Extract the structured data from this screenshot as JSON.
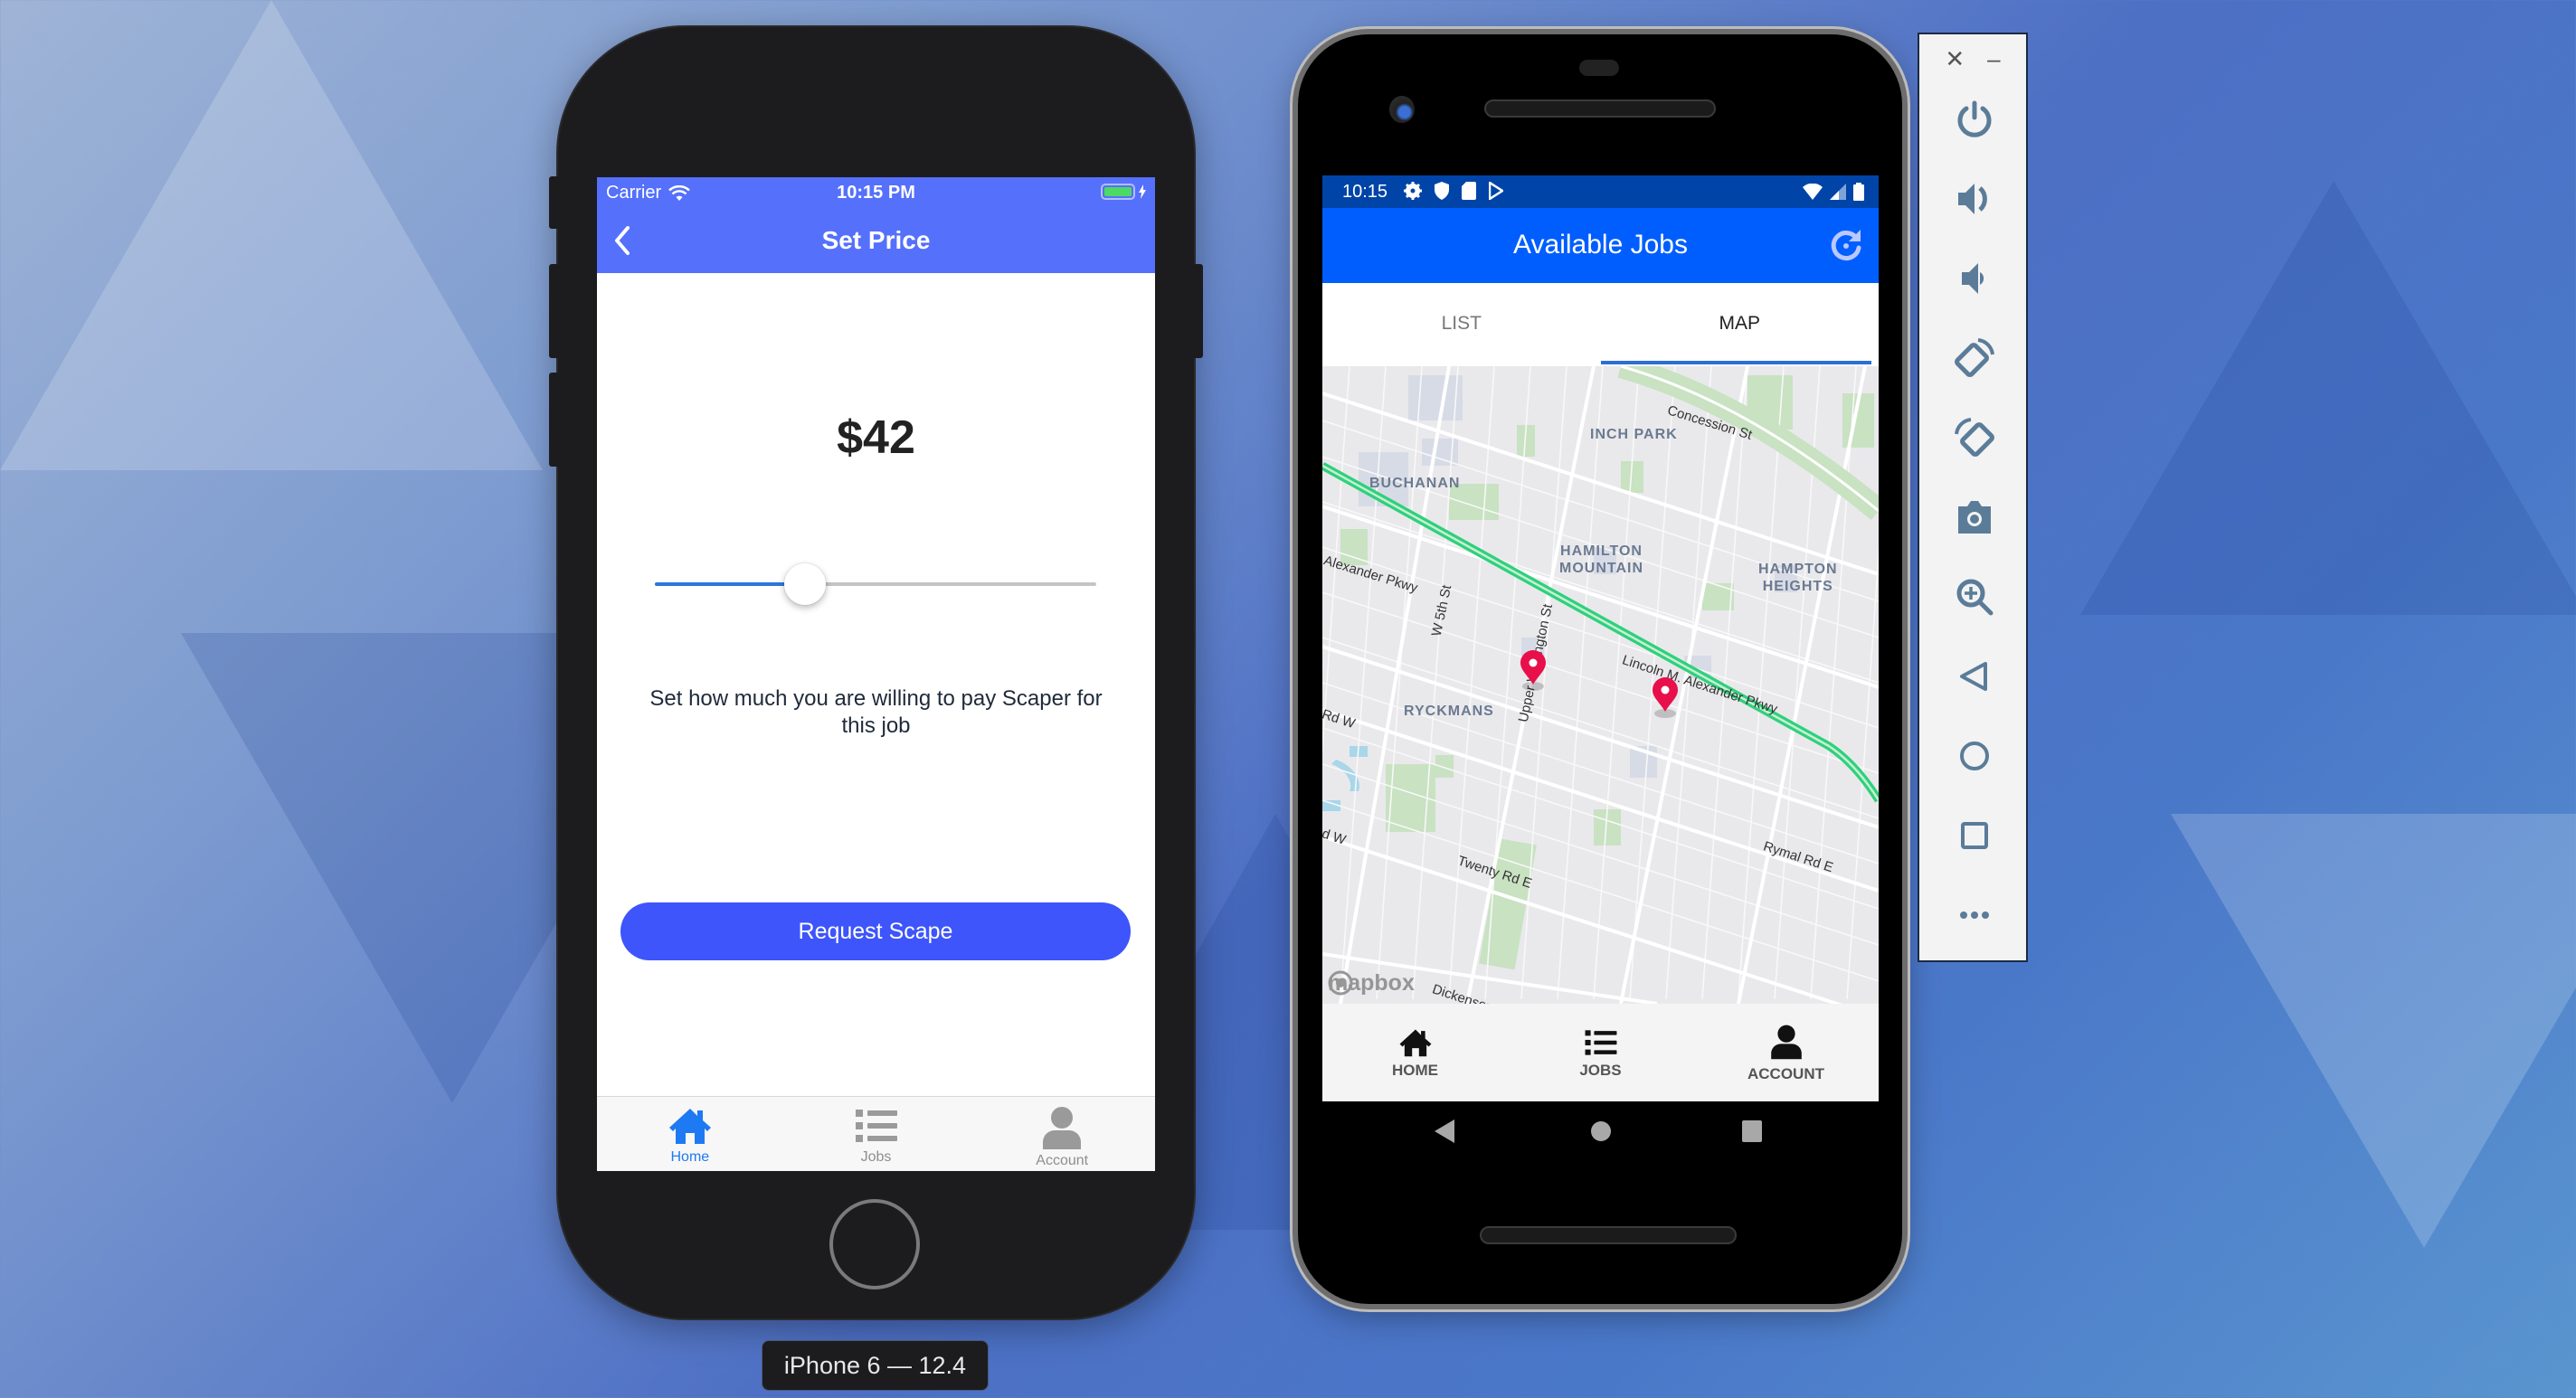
{
  "colors": {
    "ios_accent": "#5570fb",
    "ios_button": "#3d55fb",
    "ios_tab_active": "#1d7af3",
    "android_statusbar": "#0044a8",
    "android_appbar": "#005eff",
    "map_pin": "#e8104a",
    "emulator_icon": "#5b7c99"
  },
  "ios": {
    "status": {
      "carrier": "Carrier",
      "time": "10:15 PM",
      "wifi_icon": "wifi-icon",
      "battery_icon": "battery-charging-icon"
    },
    "nav": {
      "title": "Set Price",
      "back_icon": "chevron-left-icon"
    },
    "price": {
      "display": "$42",
      "slider_fraction": 0.34
    },
    "description": "Set how much you are willing to pay Scaper for this job",
    "request_button": "Request Scape",
    "tabs": [
      {
        "label": "Home",
        "icon": "home-icon",
        "active": true
      },
      {
        "label": "Jobs",
        "icon": "list-icon",
        "active": false
      },
      {
        "label": "Account",
        "icon": "user-icon",
        "active": false
      }
    ],
    "device_label": "iPhone 6 — 12.4"
  },
  "android": {
    "status": {
      "time": "10:15",
      "left_icons": [
        "gear-icon",
        "shield-icon",
        "sd-card-icon",
        "play-store-icon"
      ],
      "right_icons": [
        "wifi-icon",
        "signal-icon",
        "battery-icon"
      ]
    },
    "appbar": {
      "title": "Available Jobs",
      "refresh_icon": "refresh-icon"
    },
    "tabs": [
      {
        "label": "LIST",
        "active": false
      },
      {
        "label": "MAP",
        "active": true
      }
    ],
    "map": {
      "areas": [
        "INCH PARK",
        "BUCHANAN",
        "HAMILTON\nMOUNTAIN",
        "HAMPTON\nHEIGHTS",
        "RYCKMANS"
      ],
      "streets": [
        "Concession St",
        "Alexander Pkwy",
        "W 5th St",
        "Upper Wellington St",
        "Lincoln M. Alexander Pkwy",
        "Rd W",
        "d W",
        "Twenty Rd E",
        "Rymal Rd E",
        "Dickenson Rd E"
      ],
      "pins": 2,
      "attribution": "mapbox"
    },
    "bottom_nav": [
      {
        "label": "HOME",
        "icon": "home-icon"
      },
      {
        "label": "JOBS",
        "icon": "list-icon"
      },
      {
        "label": "ACCOUNT",
        "icon": "user-icon"
      }
    ],
    "system_nav": [
      "back-icon",
      "home-circle-icon",
      "recents-square-icon"
    ]
  },
  "emulator_panel": {
    "window_controls": [
      "close-icon",
      "minimize-icon"
    ],
    "buttons": [
      "power-icon",
      "volume-up-icon",
      "volume-down-icon",
      "rotate-left-icon",
      "rotate-right-icon",
      "camera-icon",
      "zoom-icon",
      "back-icon",
      "home-icon",
      "overview-icon",
      "more-icon"
    ]
  }
}
